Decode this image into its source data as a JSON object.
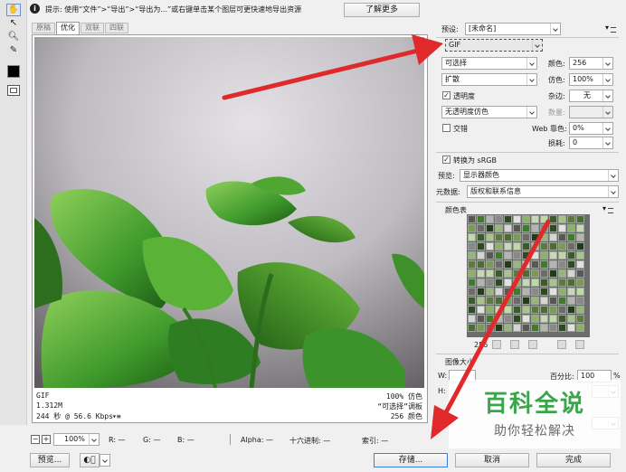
{
  "info_bar": {
    "text": "提示: 使用“文件”>“导出”>“导出为...”或右键单击某个图层可更快速地导出资源",
    "learn_more": "了解更多"
  },
  "tabs": [
    {
      "label": "原稿"
    },
    {
      "label": "优化"
    },
    {
      "label": "双联"
    },
    {
      "label": "四联"
    }
  ],
  "status": {
    "format": "GIF",
    "size": "1.312M",
    "time": "244 秒 @ 56.6 Kbps",
    "quality": "100% 仿色",
    "palette": "“可选择”调板",
    "colors": "256 颜色"
  },
  "bottom_bar": {
    "zoom": "100%",
    "r": "R: —",
    "g": "G: —",
    "b": "B: —",
    "alpha": "Alpha: —",
    "hex": "十六进制: —",
    "index": "索引: —"
  },
  "buttons": {
    "preview": "预览...",
    "save": "存储...",
    "cancel": "取消",
    "done": "完成"
  },
  "settings": {
    "preset_label": "预设:",
    "preset_value": "[未命名]",
    "format": "GIF",
    "reduction": "可选择",
    "dither_algo": "扩散",
    "colors_label": "颜色:",
    "colors_value": "256",
    "dither_label": "仿色:",
    "dither_value": "100%",
    "transparency": "透明度",
    "matte_label": "杂边:",
    "matte_value": "无",
    "trans_dither": "无透明度仿色",
    "amount_label": "数量:",
    "interlaced": "交错",
    "web_snap_label": "Web 靠色:",
    "web_snap_value": "0%",
    "lossy_label": "损耗:",
    "lossy_value": "0",
    "convert_srgb": "转换为 sRGB",
    "preview_label": "预览:",
    "preview_value": "显示器颜色",
    "metadata_label": "元数据:",
    "metadata_value": "版权和联系信息"
  },
  "color_table": {
    "title": "颜色表",
    "count": "256"
  },
  "image_size": {
    "title": "图像大小",
    "w_label": "W:",
    "h_label": "H:",
    "percent_label": "百分比:",
    "percent_value": "100",
    "percent_unit": "%"
  },
  "watermark": {
    "title": "百科全说",
    "subtitle": "助你轻松解决"
  },
  "colors": {
    "accent_red": "#e0292a",
    "watermark_green": "#3aa54a"
  }
}
